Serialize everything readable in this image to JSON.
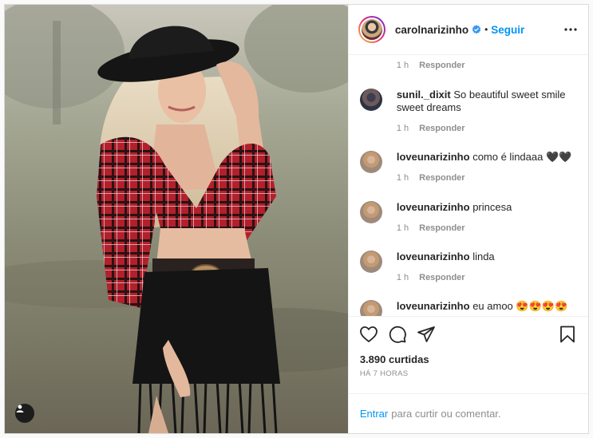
{
  "header": {
    "username": "carolnarizinho",
    "follow_label": "Seguir",
    "separator": "•"
  },
  "comments": [
    {
      "username": "",
      "text": "",
      "time": "1 h",
      "reply": "Responder"
    },
    {
      "username": "sunil._dixit",
      "text": "So beautiful sweet smile sweet dreams",
      "time": "1 h",
      "reply": "Responder"
    },
    {
      "username": "loveunarizinho",
      "text": "como é lindaaa 🖤🖤",
      "time": "1 h",
      "reply": "Responder"
    },
    {
      "username": "loveunarizinho",
      "text": "princesa",
      "time": "1 h",
      "reply": "Responder"
    },
    {
      "username": "loveunarizinho",
      "text": "linda",
      "time": "1 h",
      "reply": "Responder"
    },
    {
      "username": "loveunarizinho",
      "text": "eu amoo 😍😍😍😍",
      "time": "",
      "reply": ""
    }
  ],
  "stats": {
    "likes": "3.890 curtidas",
    "posted": "HÁ 7 HORAS"
  },
  "comment_box": {
    "login_link": "Entrar",
    "prompt": "para curtir ou comentar."
  },
  "icons": {
    "like": "heart-icon",
    "comment": "comment-icon",
    "share": "share-icon",
    "save": "bookmark-icon",
    "more": "more-options-icon",
    "verified": "verified-badge-icon",
    "user_tag": "user-tag-icon"
  },
  "colors": {
    "link": "#0095f6",
    "muted": "#8e8e8e",
    "text": "#262626",
    "border": "#efefef"
  }
}
